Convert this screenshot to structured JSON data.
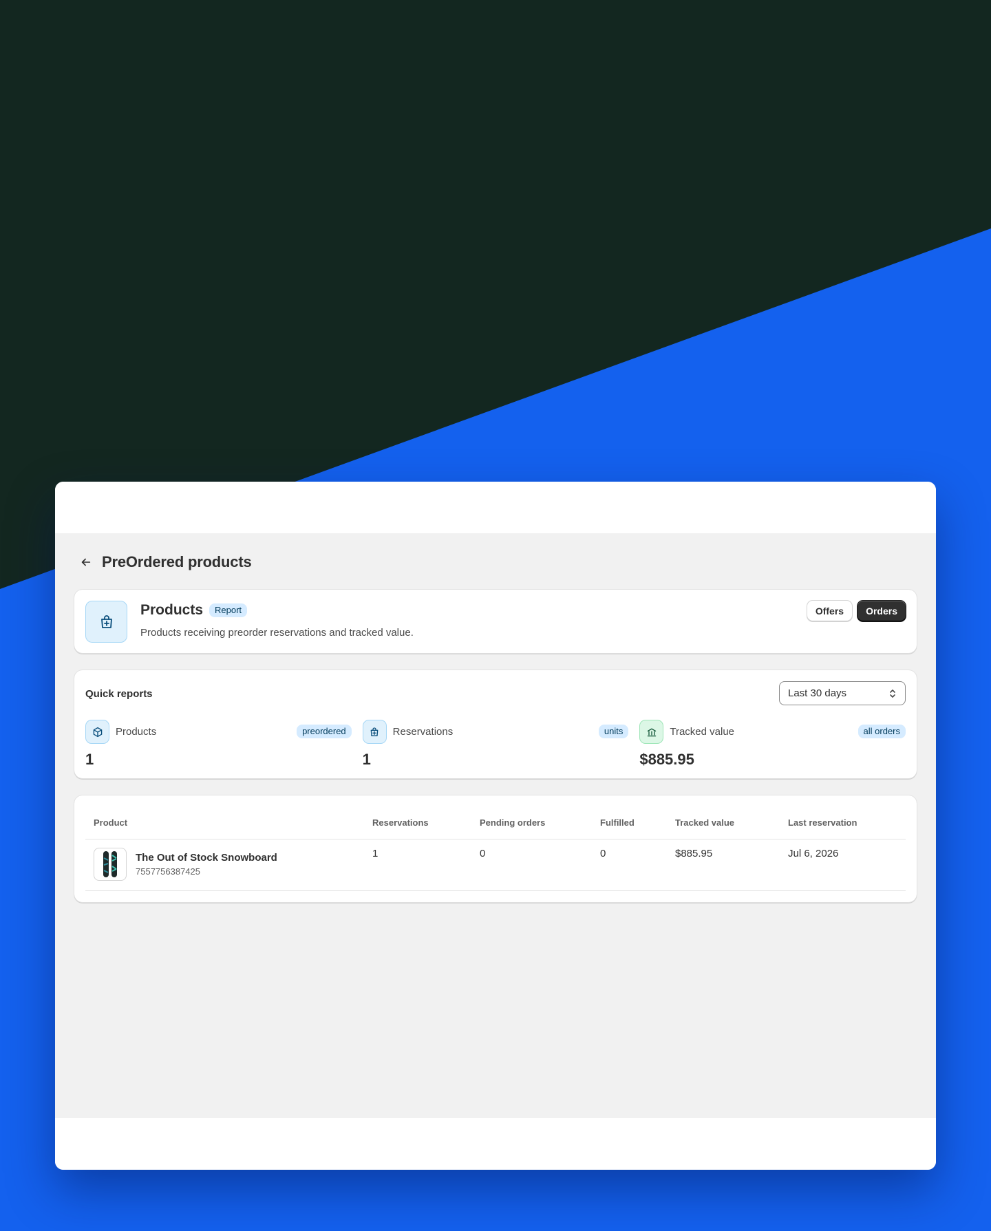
{
  "page": {
    "title": "PreOrdered products"
  },
  "hero": {
    "title": "Products",
    "badge": "Report",
    "description": "Products receiving preorder reservations and tracked value.",
    "icon": "bag-plus-icon",
    "actions": {
      "offers_label": "Offers",
      "orders_label": "Orders"
    }
  },
  "quick_reports": {
    "title": "Quick reports",
    "range_select": {
      "value": "Last 30 days"
    },
    "metrics": [
      {
        "label": "Products",
        "badge": "preordered",
        "value": "1",
        "icon": "package-icon"
      },
      {
        "label": "Reservations",
        "badge": "units",
        "value": "1",
        "icon": "bag-plus-icon"
      },
      {
        "label": "Tracked value",
        "badge": "all orders",
        "value": "$885.95",
        "icon": "finance-icon"
      }
    ]
  },
  "table": {
    "columns": [
      "Product",
      "Reservations",
      "Pending orders",
      "Fulfilled",
      "Tracked value",
      "Last reservation"
    ],
    "rows": [
      {
        "product_name": "The Out of Stock Snowboard",
        "product_id": "7557756387425",
        "reservations": "1",
        "pending_orders": "0",
        "fulfilled": "0",
        "tracked_value": "$885.95",
        "last_reservation": "Jul 6, 2026"
      }
    ]
  },
  "colors": {
    "background_blue": "#1461ee",
    "background_dark": "#132720",
    "primary_button": "#303030",
    "badge_blue": "#d5ebff"
  }
}
